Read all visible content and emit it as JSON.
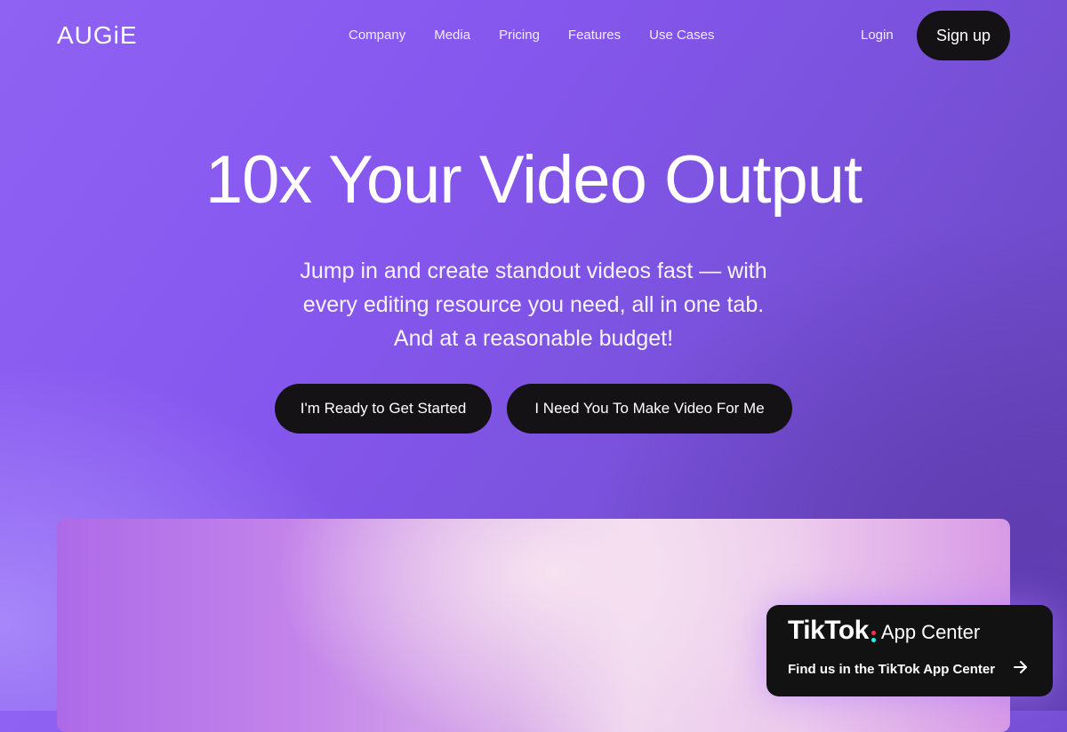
{
  "nav": {
    "logo": "AUGiE",
    "menu": [
      "Company",
      "Media",
      "Pricing",
      "Features",
      "Use Cases"
    ],
    "login": "Login",
    "signup": "Sign up"
  },
  "hero": {
    "title": "10x Your Video Output",
    "subtitle_lines": [
      "Jump in and create standout videos fast — with",
      "every editing resource you need, all in one tab.",
      "And at a reasonable budget!"
    ],
    "cta_primary": "I'm Ready to Get Started",
    "cta_secondary": "I Need You To Make Video For Me"
  },
  "tiktok_card": {
    "brand": "TikTok",
    "product": "App Center",
    "link_text": "Find us in the TikTok App Center",
    "icon": "arrow-right-icon",
    "colon_colors": [
      "#fe2c55",
      "#25f4ee"
    ]
  },
  "colors": {
    "button_bg": "#141214",
    "card_bg": "#121212",
    "accent": "#8657ee"
  }
}
